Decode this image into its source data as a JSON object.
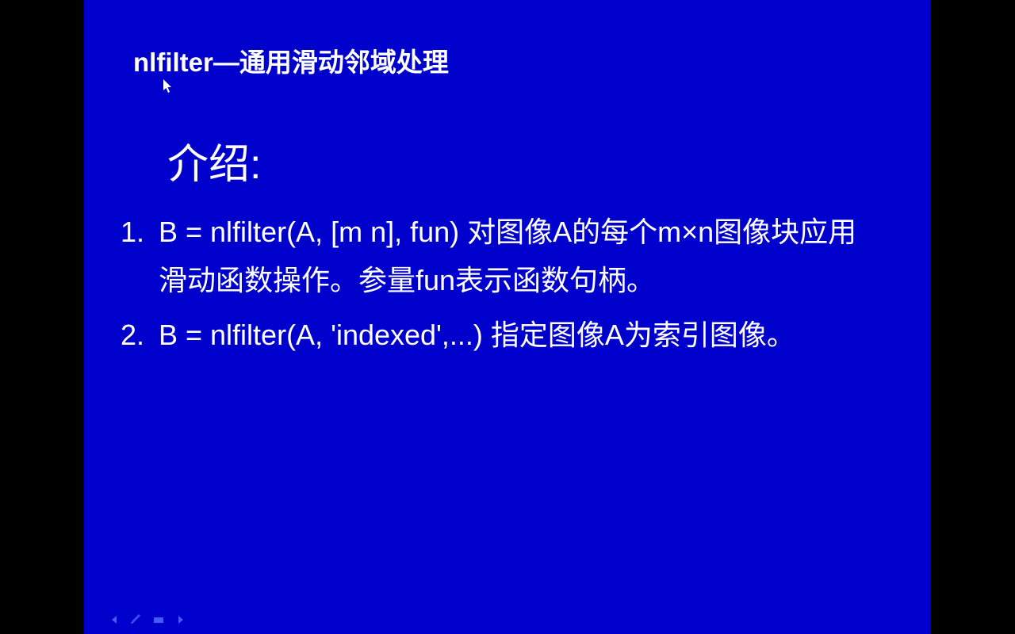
{
  "slide": {
    "title": "nlfilter—通用滑动邻域处理",
    "heading": "介绍:",
    "items": [
      {
        "number": "1.",
        "text": "B = nlfilter(A, [m n], fun)  对图像A的每个m×n图像块应用滑动函数操作。参量fun表示函数句柄。"
      },
      {
        "number": "2.",
        "text": "B = nlfilter(A, 'indexed',...)  指定图像A为索引图像。"
      }
    ]
  }
}
